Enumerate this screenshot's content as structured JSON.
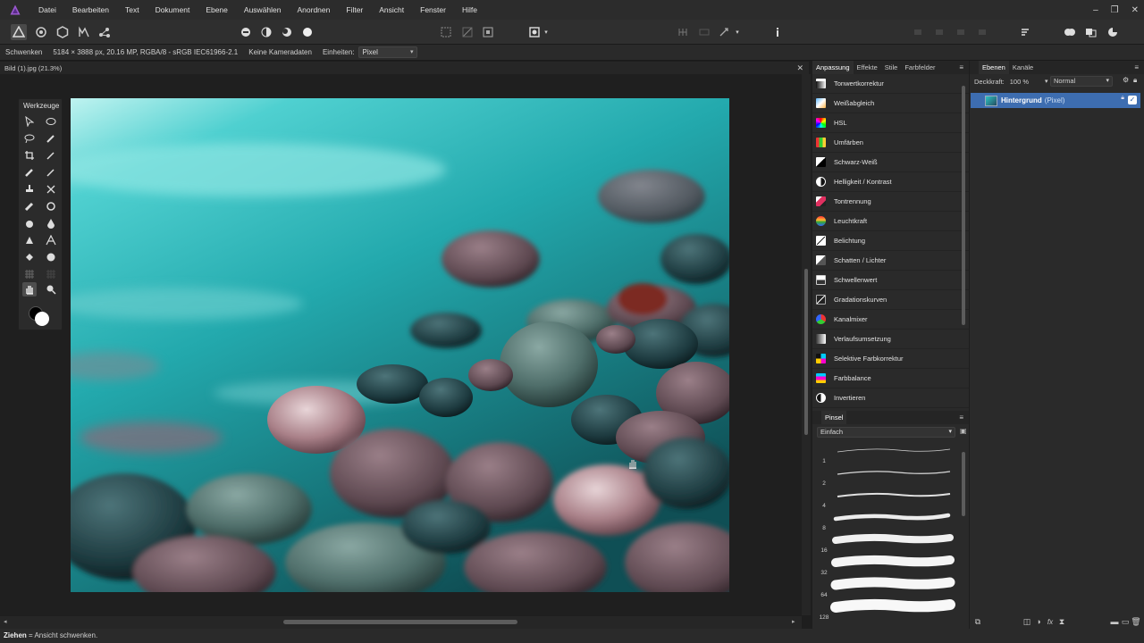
{
  "menubar": {
    "items": [
      "Datei",
      "Bearbeiten",
      "Text",
      "Dokument",
      "Ebene",
      "Auswählen",
      "Anordnen",
      "Filter",
      "Ansicht",
      "Fenster",
      "Hilfe"
    ],
    "logo_icon": "affinity-photo-logo",
    "accent_color": "#9b59d0"
  },
  "contextbar": {
    "tool_name": "Schwenken",
    "image_info": "5184 × 3888 px, 20.16 MP, RGBA/8 - sRGB IEC61966-2.1",
    "camera": "Keine Kameradaten",
    "units_label": "Einheiten:",
    "units_value": "Pixel"
  },
  "document": {
    "tab_title": "Bild (1).jpg (21.3%)"
  },
  "tools": {
    "title": "Werkzeuge"
  },
  "adjustments": {
    "tabs": [
      "Anpassung",
      "Effekte",
      "Stile",
      "Farbfelder"
    ],
    "items": [
      {
        "label": "Tonwertkorrektur",
        "icon": "levels-icon"
      },
      {
        "label": "Weißabgleich",
        "icon": "white-balance-icon"
      },
      {
        "label": "HSL",
        "icon": "hsl-icon"
      },
      {
        "label": "Umfärben",
        "icon": "recolor-icon"
      },
      {
        "label": "Schwarz-Weiß",
        "icon": "black-white-icon"
      },
      {
        "label": "Helligkeit / Kontrast",
        "icon": "brightness-contrast-icon"
      },
      {
        "label": "Tontrennung",
        "icon": "posterize-icon"
      },
      {
        "label": "Leuchtkraft",
        "icon": "vibrance-icon"
      },
      {
        "label": "Belichtung",
        "icon": "exposure-icon"
      },
      {
        "label": "Schatten / Lichter",
        "icon": "shadows-highlights-icon"
      },
      {
        "label": "Schwellenwert",
        "icon": "threshold-icon"
      },
      {
        "label": "Gradationskurven",
        "icon": "curves-icon"
      },
      {
        "label": "Kanalmixer",
        "icon": "channel-mixer-icon"
      },
      {
        "label": "Verlaufsumsetzung",
        "icon": "gradient-map-icon"
      },
      {
        "label": "Selektive Farbkorrektur",
        "icon": "selective-color-icon"
      },
      {
        "label": "Farbbalance",
        "icon": "color-balance-icon"
      },
      {
        "label": "Invertieren",
        "icon": "invert-icon"
      }
    ]
  },
  "brushes": {
    "tab": "Pinsel",
    "category": "Einfach",
    "sizes": [
      "1",
      "2",
      "4",
      "8",
      "16",
      "32",
      "64",
      "128"
    ]
  },
  "layers": {
    "tabs": [
      "Ebenen",
      "Kanäle"
    ],
    "opacity_label": "Deckkraft:",
    "opacity_value": "100 %",
    "blend_mode": "Normal",
    "layer_name": "Hintergrund",
    "layer_type": "(Pixel)",
    "selection_color": "#3d6db0"
  },
  "status": {
    "action": "Ziehen",
    "hint": " = Ansicht schwenken."
  }
}
